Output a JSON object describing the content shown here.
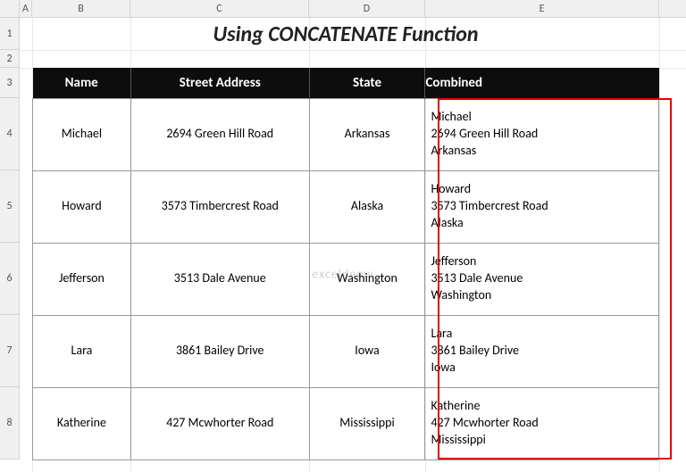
{
  "columns": {
    "A": "A",
    "B": "B",
    "C": "C",
    "D": "D",
    "E": "E"
  },
  "rowLabels": {
    "r1": "1",
    "r2": "2",
    "r3": "3",
    "r4": "4",
    "r5": "5",
    "r6": "6",
    "r7": "7",
    "r8": "8"
  },
  "title": "Using CONCATENATE Function",
  "headers": {
    "name": "Name",
    "street": "Street Address",
    "state": "State",
    "combined": "Combined"
  },
  "rows": [
    {
      "name": "Michael",
      "street": "2694 Green Hill Road",
      "state": "Arkansas",
      "c1": "Michael",
      "c2": "2694 Green Hill Road",
      "c3": "Arkansas"
    },
    {
      "name": "Howard",
      "street": "3573 Timbercrest Road",
      "state": "Alaska",
      "c1": "Howard",
      "c2": "3573 Timbercrest Road",
      "c3": "Alaska"
    },
    {
      "name": "Jefferson",
      "street": "3513 Dale Avenue",
      "state": "Washington",
      "c1": "Jefferson",
      "c2": "3513 Dale Avenue",
      "c3": "Washington"
    },
    {
      "name": "Lara",
      "street": "3861 Bailey Drive",
      "state": "Iowa",
      "c1": "Lara",
      "c2": "3861 Bailey Drive",
      "c3": "Iowa"
    },
    {
      "name": "Katherine",
      "street": "427 Mcwhorter Road",
      "state": "Mississippi",
      "c1": "Katherine",
      "c2": "427 Mcwhorter Road",
      "c3": "Mississippi"
    }
  ],
  "watermark": "exceldemy"
}
